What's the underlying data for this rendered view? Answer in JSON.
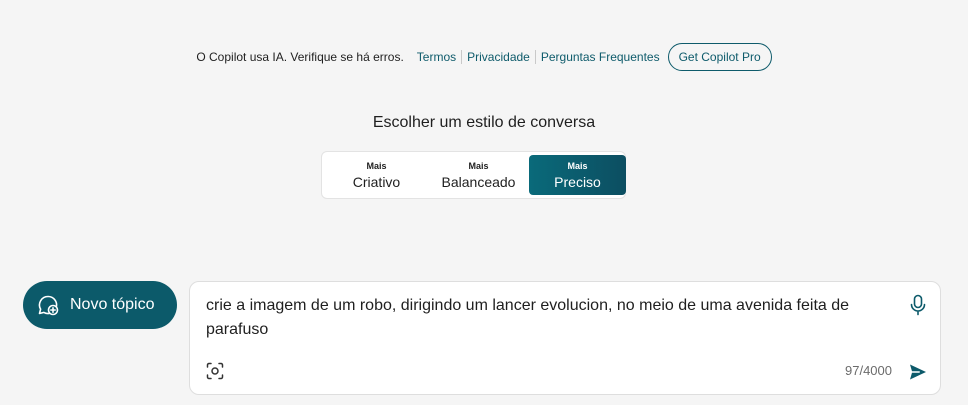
{
  "disclaimer": {
    "text": "O Copilot usa IA. Verifique se há erros.",
    "links": [
      "Termos",
      "Privacidade",
      "Perguntas Frequentes"
    ],
    "pro_button": "Get Copilot Pro"
  },
  "style_selector": {
    "title": "Escolher um estilo de conversa",
    "options": [
      {
        "prefix": "Mais",
        "label": "Criativo",
        "selected": false
      },
      {
        "prefix": "Mais",
        "label": "Balanceado",
        "selected": false
      },
      {
        "prefix": "Mais",
        "label": "Preciso",
        "selected": true
      }
    ]
  },
  "new_topic": {
    "label": "Novo tópico",
    "icon": "chat-add-icon"
  },
  "composer": {
    "value": "crie a imagem de um robo, dirigindo um lancer evolucion, no meio de uma avenida feita de parafuso",
    "char_count": "97/4000",
    "icons": [
      "microphone-icon",
      "visual-search-icon",
      "send-icon"
    ]
  },
  "colors": {
    "accent": "#0c5a6a",
    "link": "#0e5b6b",
    "background": "#f5f5f5"
  }
}
